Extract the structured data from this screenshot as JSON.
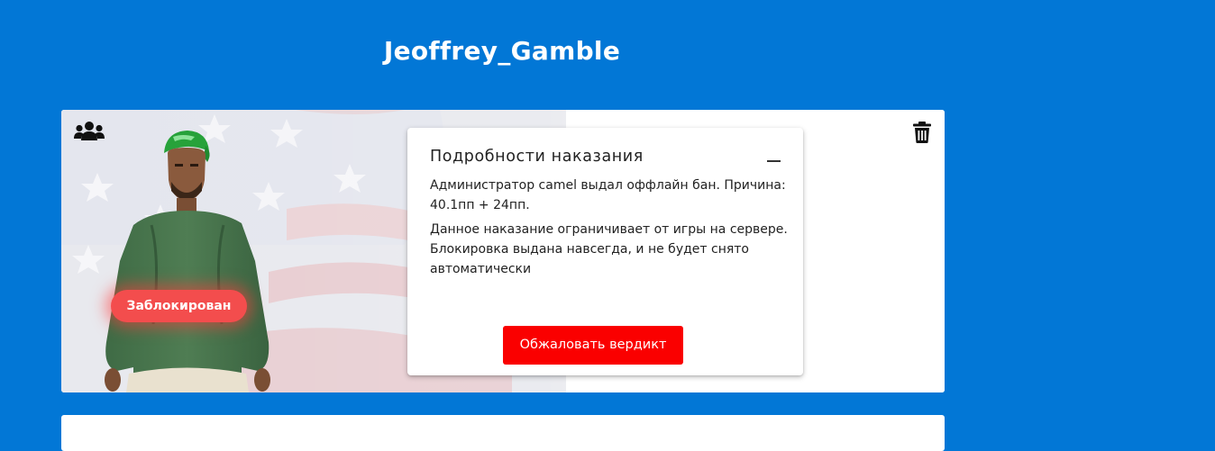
{
  "profile": {
    "nickname": "Jeoffrey_Gamble"
  },
  "punishment_card": {
    "status_label": "Заблокирован",
    "icons": {
      "left": "group-icon",
      "right": "trash-icon"
    },
    "details": {
      "title": "Подробности наказания",
      "line1": "Администратор camel выдал оффлайн бан. Причина: 40.1пп + 24пп.",
      "line2": "Данное наказание ограничивает от игры на сервере. Блокировка выдана навсегда, и не будет снято автоматически",
      "appeal_button": "Обжаловать вердикт"
    }
  },
  "colors": {
    "background": "#0277d6",
    "status_pill": "#f34d4d",
    "appeal_button": "#fa0000"
  }
}
